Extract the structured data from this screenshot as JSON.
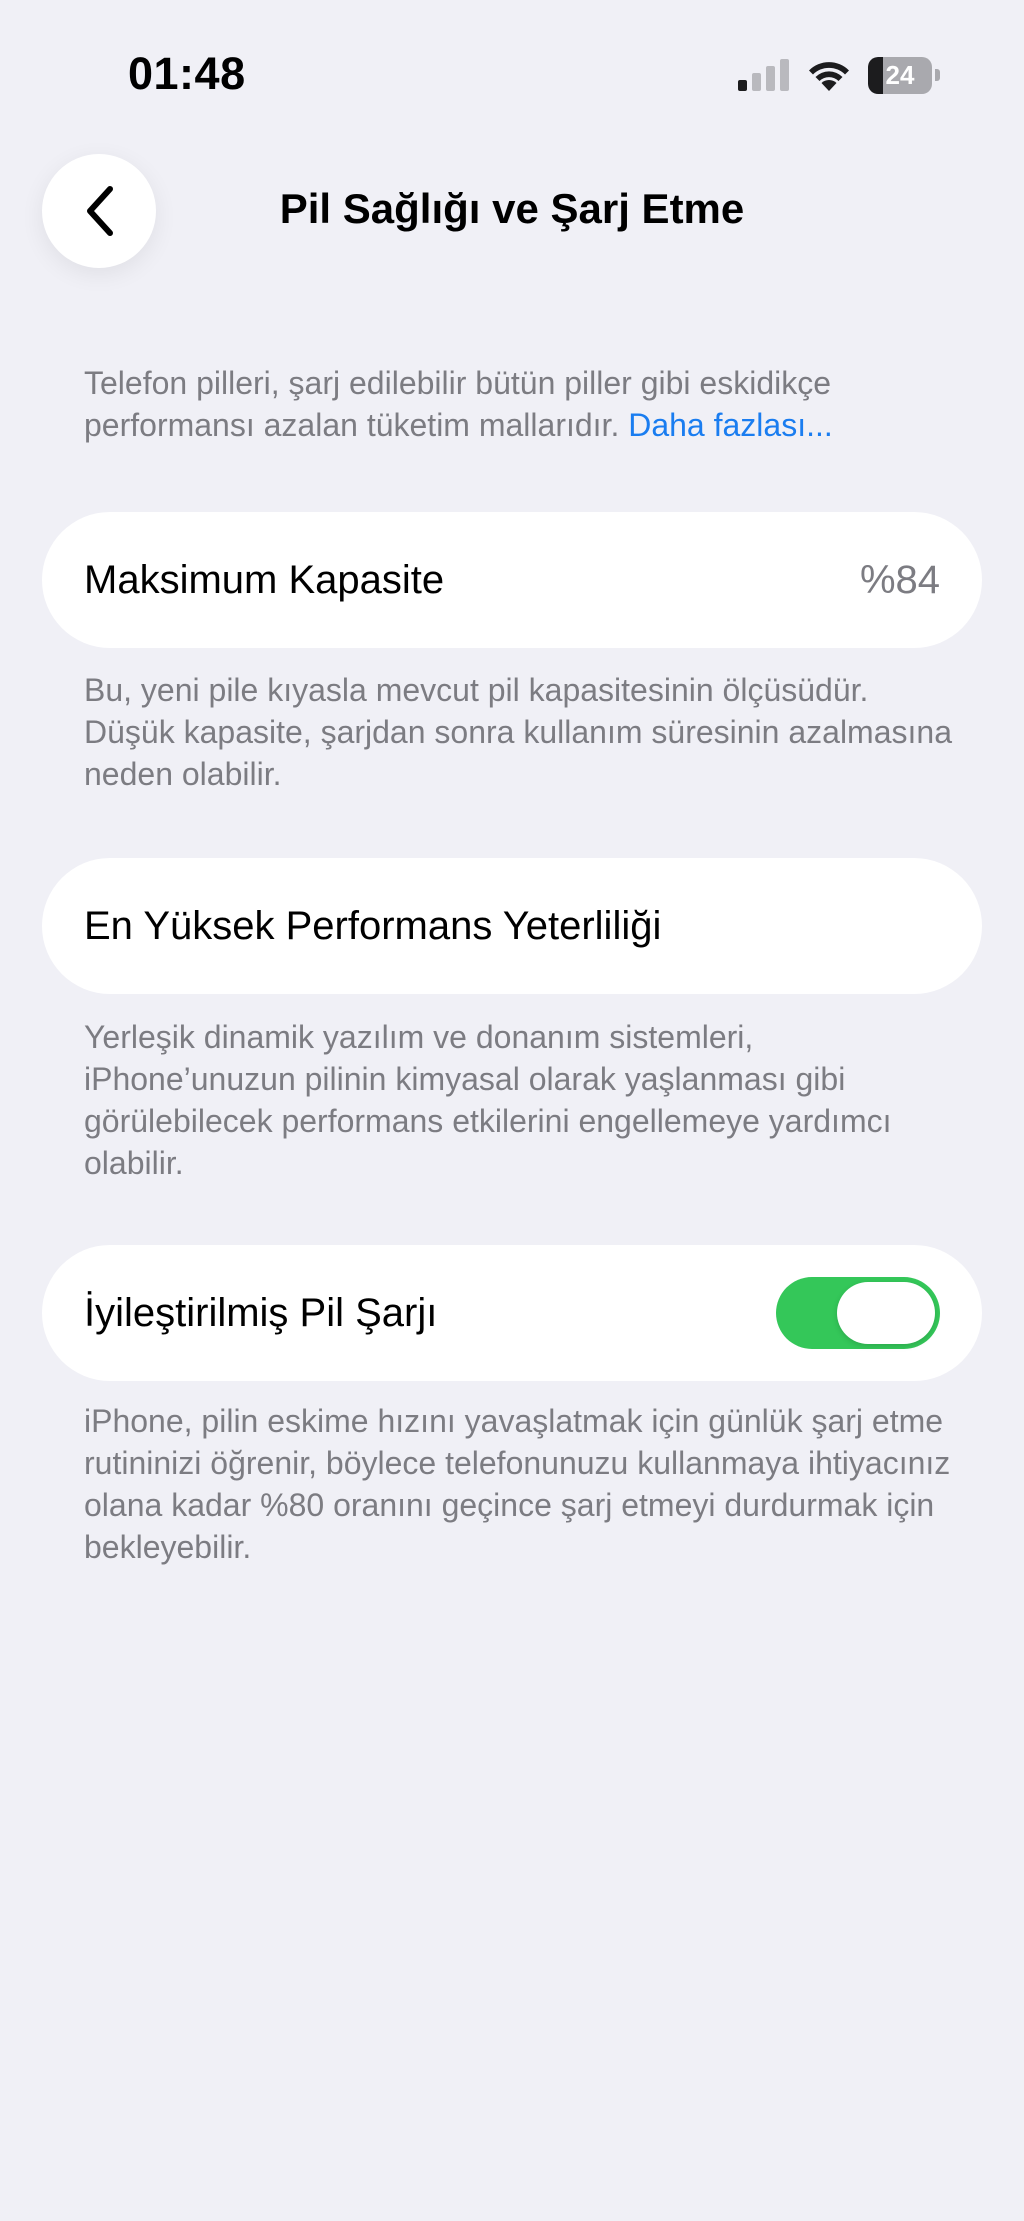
{
  "status_bar": {
    "time": "01:48",
    "battery_level": "24",
    "battery_fraction": 0.24,
    "signal_icon": "cellular-signal-icon",
    "wifi_icon": "wifi-icon"
  },
  "nav": {
    "back_icon": "chevron-left-icon",
    "title": "Pil Sağlığı ve Şarj Etme"
  },
  "intro": {
    "text": "Telefon pilleri, şarj edilebilir bütün piller gibi eskidikçe performansı azalan tüketim mallarıdır. ",
    "link": "Daha fazlası..."
  },
  "max_capacity": {
    "label": "Maksimum Kapasite",
    "value": "%84",
    "footnote": "Bu, yeni pile kıyasla mevcut pil kapasitesinin ölçüsüdür. Düşük kapasite, şarjdan sonra kullanım süresinin azalmasına neden olabilir."
  },
  "peak_performance": {
    "label": "En Yüksek Performans Yeterliliği",
    "footnote": "Yerleşik dinamik yazılım ve donanım sistemleri, iPhone’unuzun pilinin kimyasal olarak yaşlanması gibi görülebilecek performans etkilerini engellemeye yardımcı olabilir."
  },
  "optimized_charging": {
    "label": "İyileştirilmiş Pil Şarjı",
    "enabled": true,
    "footnote": "iPhone, pilin eskime hızını yavaşlatmak için günlük şarj etme rutininizi öğrenir, böylece telefonunuzu kullanmaya ihtiyacınız olana kadar %80 oranını geçince şarj etmeyi durdurmak için bekleyebilir."
  },
  "colors": {
    "background": "#f0f0f6",
    "link": "#1a7df0",
    "toggle_on": "#34c759",
    "secondary_text": "#7c7c82"
  }
}
